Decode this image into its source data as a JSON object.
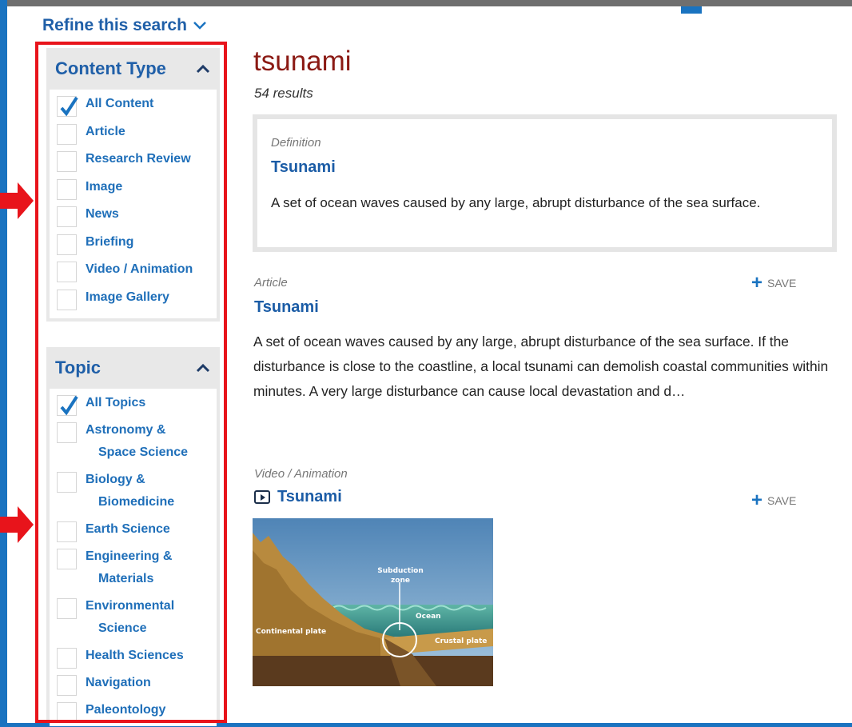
{
  "refine": {
    "label": "Refine this search"
  },
  "content_type": {
    "title": "Content Type",
    "options": [
      {
        "label": "All Content",
        "checked": true
      },
      {
        "label": "Article",
        "checked": false
      },
      {
        "label": "Research Review",
        "checked": false
      },
      {
        "label": "Image",
        "checked": false
      },
      {
        "label": "News",
        "checked": false
      },
      {
        "label": "Briefing",
        "checked": false
      },
      {
        "label": "Video / Animation",
        "checked": false
      },
      {
        "label": "Image Gallery",
        "checked": false
      }
    ]
  },
  "topic": {
    "title": "Topic",
    "options": [
      {
        "label": "All Topics",
        "checked": true
      },
      {
        "label": "Astronomy &",
        "label2": "Space Science",
        "checked": false
      },
      {
        "label": "Biology &",
        "label2": "Biomedicine",
        "checked": false
      },
      {
        "label": "Earth Science",
        "checked": false
      },
      {
        "label": "Engineering &",
        "label2": "Materials",
        "checked": false
      },
      {
        "label": "Environmental",
        "label2": "Science",
        "checked": false
      },
      {
        "label": "Health Sciences",
        "checked": false
      },
      {
        "label": "Navigation",
        "checked": false
      },
      {
        "label": "Paleontology",
        "checked": false
      }
    ]
  },
  "results": {
    "query": "tsunami",
    "count": "54 results",
    "definition": {
      "type": "Definition",
      "title": "Tsunami",
      "text": "A set of ocean waves caused by any large, abrupt disturbance of the sea surface."
    },
    "article": {
      "type": "Article",
      "title": "Tsunami",
      "text": "A set of ocean waves caused by any large, abrupt disturbance of the sea surface. If the disturbance is close to the coastline, a local tsunami can demolish coastal communities within minutes. A very large disturbance can cause local devastation and d…",
      "save": "SAVE"
    },
    "video": {
      "type": "Video / Animation",
      "title": "Tsunami",
      "save": "SAVE",
      "thumbnail": {
        "subduction": "Subduction zone",
        "ocean": "Ocean",
        "continental": "Continental plate",
        "crustal": "Crustal plate"
      }
    }
  },
  "colors": {
    "highlight_border": "#e8141b",
    "link_blue": "#1f6fb9",
    "query_red": "#8b1a14"
  }
}
